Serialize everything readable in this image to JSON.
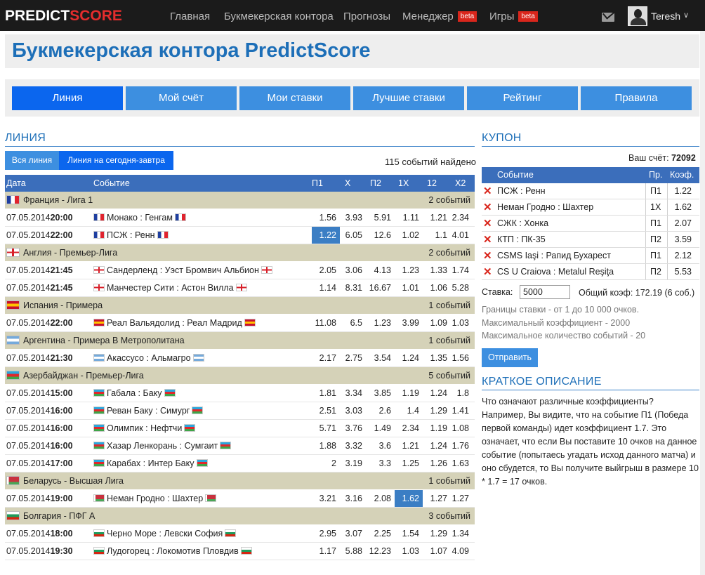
{
  "top": {
    "logo_part1": "PREDICT",
    "logo_part2": "SCORE",
    "nav": [
      "Главная",
      "Букмекерская контора",
      "Прогнозы",
      "Менеджер",
      "Игры"
    ],
    "beta": "beta",
    "user": "Teresh"
  },
  "page_title": "Букмекерская контора PredictScore",
  "tabs": [
    "Линия",
    "Мой счёт",
    "Мои ставки",
    "Лучшие ставки",
    "Рейтинг",
    "Правила"
  ],
  "line": {
    "heading": "ЛИНИЯ",
    "btn_all": "Вся линия",
    "btn_today": "Линия на сегодня-завтра",
    "found": "115 событий найдено",
    "headers": [
      "Дата",
      "Событие",
      "П1",
      "X",
      "П2",
      "1X",
      "12",
      "X2"
    ],
    "groups": [
      {
        "name": "Франция - Лига 1",
        "count": "2 событий",
        "flag": "france",
        "rows": [
          {
            "date": "07.05.2014",
            "time": "20:00",
            "event": "Монако : Генгам",
            "flag": "france",
            "odds": [
              "1.56",
              "3.93",
              "5.91",
              "1.11",
              "1.21",
              "2.34"
            ],
            "hl": -1
          },
          {
            "date": "07.05.2014",
            "time": "22:00",
            "event": "ПСЖ : Ренн",
            "flag": "france",
            "odds": [
              "1.22",
              "6.05",
              "12.6",
              "1.02",
              "1.1",
              "4.01"
            ],
            "hl": 0
          }
        ]
      },
      {
        "name": "Англия - Премьер-Лига",
        "count": "2 событий",
        "flag": "england",
        "rows": [
          {
            "date": "07.05.2014",
            "time": "21:45",
            "event": "Сандерленд : Уэст Бромвич Альбион",
            "flag": "england",
            "odds": [
              "2.05",
              "3.06",
              "4.13",
              "1.23",
              "1.33",
              "1.74"
            ],
            "hl": -1
          },
          {
            "date": "07.05.2014",
            "time": "21:45",
            "event": "Манчестер Сити : Астон Вилла",
            "flag": "england",
            "odds": [
              "1.14",
              "8.31",
              "16.67",
              "1.01",
              "1.06",
              "5.28"
            ],
            "hl": -1
          }
        ]
      },
      {
        "name": "Испания - Примера",
        "count": "1 событий",
        "flag": "spain",
        "rows": [
          {
            "date": "07.05.2014",
            "time": "22:00",
            "event": "Реал Вальядолид : Реал Мадрид",
            "flag": "spain",
            "odds": [
              "11.08",
              "6.5",
              "1.23",
              "3.99",
              "1.09",
              "1.03"
            ],
            "hl": -1
          }
        ]
      },
      {
        "name": "Аргентина - Примера B Метрополитана",
        "count": "1 событий",
        "flag": "argentina",
        "rows": [
          {
            "date": "07.05.2014",
            "time": "21:30",
            "event": "Акассусо : Альмагро",
            "flag": "argentina",
            "odds": [
              "2.17",
              "2.75",
              "3.54",
              "1.24",
              "1.35",
              "1.56"
            ],
            "hl": -1
          }
        ]
      },
      {
        "name": "Азербайджан - Премьер-Лига",
        "count": "5 событий",
        "flag": "azerbaijan",
        "rows": [
          {
            "date": "07.05.2014",
            "time": "15:00",
            "event": "Габала : Баку",
            "flag": "azerbaijan",
            "odds": [
              "1.81",
              "3.34",
              "3.85",
              "1.19",
              "1.24",
              "1.8"
            ],
            "hl": -1
          },
          {
            "date": "07.05.2014",
            "time": "16:00",
            "event": "Реван Баку : Симург",
            "flag": "azerbaijan",
            "odds": [
              "2.51",
              "3.03",
              "2.6",
              "1.4",
              "1.29",
              "1.41"
            ],
            "hl": -1
          },
          {
            "date": "07.05.2014",
            "time": "16:00",
            "event": "Олимпик : Нефтчи",
            "flag": "azerbaijan",
            "odds": [
              "5.71",
              "3.76",
              "1.49",
              "2.34",
              "1.19",
              "1.08"
            ],
            "hl": -1
          },
          {
            "date": "07.05.2014",
            "time": "16:00",
            "event": "Хазар Ленкорань : Сумгаит",
            "flag": "azerbaijan",
            "odds": [
              "1.88",
              "3.32",
              "3.6",
              "1.21",
              "1.24",
              "1.76"
            ],
            "hl": -1
          },
          {
            "date": "07.05.2014",
            "time": "17:00",
            "event": "Карабах : Интер Баку",
            "flag": "azerbaijan",
            "odds": [
              "2",
              "3.19",
              "3.3",
              "1.25",
              "1.26",
              "1.63"
            ],
            "hl": -1
          }
        ]
      },
      {
        "name": "Беларусь - Высшая Лига",
        "count": "1 событий",
        "flag": "belarus",
        "rows": [
          {
            "date": "07.05.2014",
            "time": "19:00",
            "event": "Неман Гродно : Шахтер",
            "flag": "belarus",
            "odds": [
              "3.21",
              "3.16",
              "2.08",
              "1.62",
              "1.27",
              "1.27"
            ],
            "hl": 3
          }
        ]
      },
      {
        "name": "Болгария - ПФГ А",
        "count": "3 событий",
        "flag": "bulgaria",
        "rows": [
          {
            "date": "07.05.2014",
            "time": "18:00",
            "event": "Черно Море : Левски София",
            "flag": "bulgaria",
            "odds": [
              "2.95",
              "3.07",
              "2.25",
              "1.54",
              "1.29",
              "1.34"
            ],
            "hl": -1
          },
          {
            "date": "07.05.2014",
            "time": "19:30",
            "event": "Лудогорец : Локомотив Пловдив",
            "flag": "bulgaria",
            "odds": [
              "1.17",
              "5.88",
              "12.23",
              "1.03",
              "1.07",
              "4.09"
            ],
            "hl": -1
          }
        ]
      }
    ]
  },
  "coupon": {
    "heading": "КУПОН",
    "account_label": "Ваш счёт:",
    "account_value": "72092",
    "headers": [
      "Событие",
      "Пр.",
      "Коэф."
    ],
    "rows": [
      {
        "event": "ПСЖ : Ренн",
        "pick": "П1",
        "odd": "1.22"
      },
      {
        "event": "Неман Гродно : Шахтер",
        "pick": "1X",
        "odd": "1.62"
      },
      {
        "event": "СЖК : Хонка",
        "pick": "П1",
        "odd": "2.07"
      },
      {
        "event": "КТП : ПК-35",
        "pick": "П2",
        "odd": "3.59"
      },
      {
        "event": "CSMS Iaşi : Рапид Бухарест",
        "pick": "П1",
        "odd": "2.12"
      },
      {
        "event": "CS U Craiova : Metalul Reşiţa",
        "pick": "П2",
        "odd": "5.53"
      }
    ],
    "stake_label": "Ставка:",
    "stake_value": "5000",
    "total": "Общий коэф: 172.19 (6 соб.)",
    "limits": [
      "Границы ставки - от 1 до 10 000 очков.",
      "Максимальный коэффициент - 2000",
      "Максимальное количество событий - 20"
    ],
    "send": "Отправить"
  },
  "desc": {
    "heading": "КРАТКОЕ ОПИСАНИЕ",
    "text": "Что означают различные коэффициенты? Например, Вы видите, что на событие П1 (Победа первой команды) идет коэффициент 1.7. Это означает, что если Вы поставите 10 очков на данное событие (попытаесь угадать исход данного матча) и оно сбудется, то Вы получите выйгрыш в размере 10 * 1.7 = 17 очков."
  },
  "flag_colors": {
    "france": [
      "#1f3fa0",
      "#ffffff",
      "#e0232e"
    ],
    "england": [
      "#ffffff",
      "#d8202a"
    ],
    "spain": [
      "#c8102e",
      "#ffc400",
      "#c8102e"
    ],
    "argentina": [
      "#75aadb",
      "#ffffff",
      "#75aadb"
    ],
    "azerbaijan": [
      "#2aa6dc",
      "#e2262b",
      "#3fa548"
    ],
    "belarus": [
      "#c8313e",
      "#4aa657"
    ],
    "bulgaria": [
      "#ffffff",
      "#1f9b5b",
      "#d62612"
    ]
  }
}
